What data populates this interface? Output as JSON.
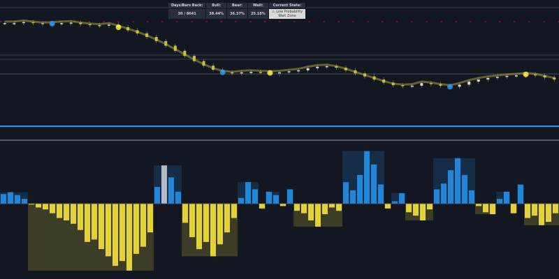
{
  "table": {
    "headers": [
      "Days/Bars Back:",
      "Bull:",
      "Bear:",
      "Wait:",
      "Current State:"
    ],
    "values": [
      "30 / 8641",
      "38.44%",
      "36.37%",
      "25.18%"
    ],
    "state_line1": "Low Probability",
    "state_line2": "Wait Zone",
    "state_icon": "warning-icon"
  },
  "colors": {
    "background": "#131722",
    "bull": "#2196f3",
    "bear": "#ffeb3b",
    "wait": "#d1d4dc",
    "candle_up": "#d9d9d9",
    "candle_down": "#c8c23a",
    "ref_red": "#b71c1c"
  },
  "chart_data": [
    {
      "type": "candlestick",
      "panel": "price",
      "grid": false,
      "close": [
        100,
        100,
        100.2,
        100,
        99.8,
        99.9,
        100,
        100.1,
        99.8,
        99.6,
        99.5,
        99.7,
        99.2,
        98.6,
        98.0,
        97.3,
        96.5,
        95.6,
        94.6,
        93.6,
        92.6,
        91.7,
        90.9,
        90.4,
        90.2,
        90.4,
        90.5,
        90.4,
        90.3,
        90.4,
        90.6,
        90.8,
        91.2,
        91.5,
        91.6,
        91.3,
        90.8,
        90.2,
        89.6,
        89.0,
        88.4,
        87.9,
        87.7,
        87.8,
        88.3,
        88.1,
        87.8,
        87.6,
        88.0,
        88.6,
        89.0,
        89.3,
        89.5,
        89.7,
        89.8,
        90.0,
        89.8,
        89.4,
        89.0
      ],
      "markers": [
        {
          "index": 5,
          "color": "bull"
        },
        {
          "index": 12,
          "color": "bear"
        },
        {
          "index": 23,
          "color": "bull"
        },
        {
          "index": 28,
          "color": "bear"
        },
        {
          "index": 47,
          "color": "bull"
        },
        {
          "index": 55,
          "color": "bear"
        }
      ]
    },
    {
      "type": "bar",
      "panel": "oscillator",
      "grid": false,
      "values": [
        20,
        24,
        18,
        10,
        -2,
        -8,
        -12,
        -20,
        -30,
        -35,
        -42,
        -55,
        -80,
        -75,
        -95,
        -110,
        -130,
        -120,
        -140,
        -105,
        -90,
        -60,
        35,
        80,
        55,
        25,
        -40,
        -70,
        -95,
        -80,
        -110,
        -85,
        -60,
        -30,
        12,
        45,
        30,
        -10,
        25,
        18,
        -5,
        30,
        -15,
        -20,
        -35,
        -48,
        -22,
        -8,
        -15,
        45,
        28,
        60,
        110,
        82,
        40,
        -10,
        5,
        22,
        -18,
        -25,
        -35,
        -12,
        30,
        42,
        70,
        95,
        60,
        28,
        -5,
        -18,
        -22,
        10,
        25,
        -20,
        40,
        -30,
        -25,
        -45,
        -38,
        -20
      ]
    }
  ]
}
